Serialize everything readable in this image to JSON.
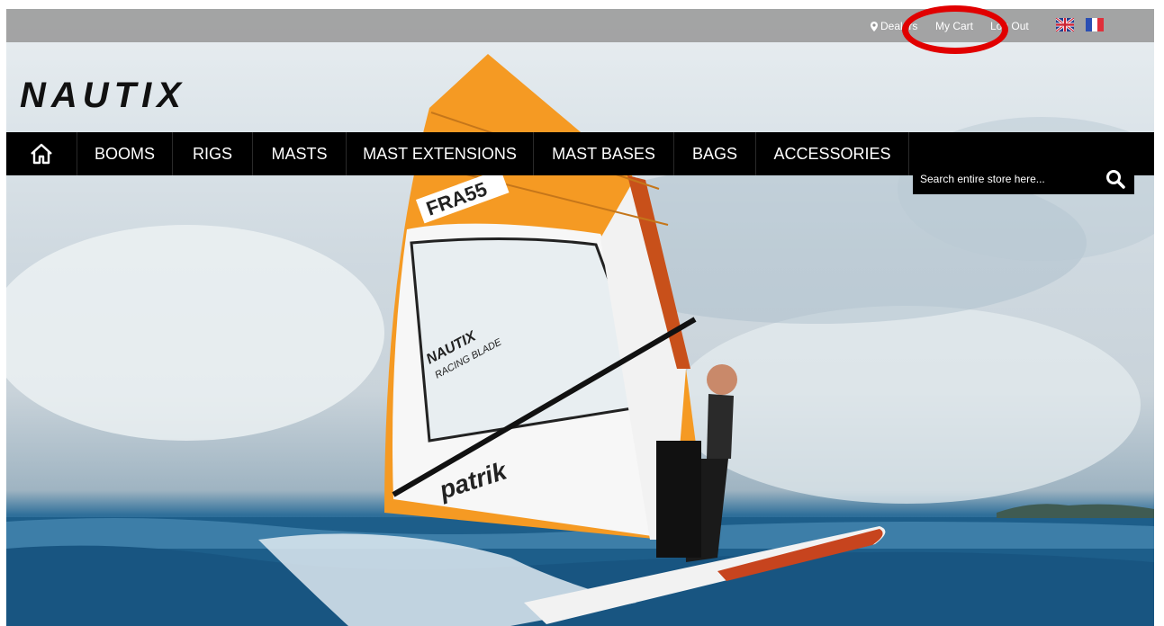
{
  "brand": {
    "name": "NAUTIX"
  },
  "topbar": {
    "dealers_label": "Dealers",
    "cart_label": "My Cart",
    "logout_label": "Log Out",
    "languages": [
      "English",
      "Français"
    ]
  },
  "nav": {
    "items": [
      {
        "label": "BOOMS"
      },
      {
        "label": "RIGS"
      },
      {
        "label": "MASTS"
      },
      {
        "label": "MAST EXTENSIONS"
      },
      {
        "label": "MAST BASES"
      },
      {
        "label": "BAGS"
      },
      {
        "label": "ACCESSORIES"
      }
    ]
  },
  "search": {
    "placeholder": "Search entire store here..."
  },
  "hero": {
    "sail_number": "FRA55",
    "sail_brand": "patrik",
    "sail_side_text": "NAUTIX",
    "sail_side_text_2": "RACING BLADE"
  },
  "colors": {
    "accent": "#e10000",
    "nav_bg": "#000000",
    "sail": "#f59a23"
  }
}
